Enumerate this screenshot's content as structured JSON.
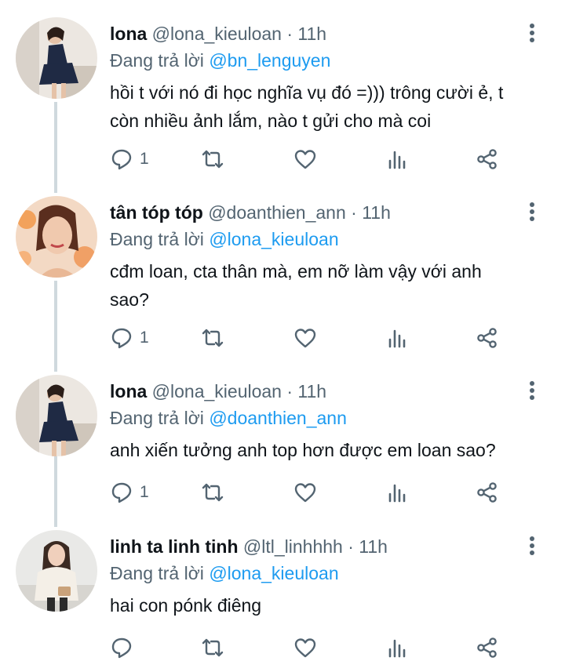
{
  "replying_label": "Đang trả lời",
  "colors": {
    "accent": "#1d9bf0",
    "muted": "#536471",
    "thread_line": "#cfd9de"
  },
  "tweets": [
    {
      "name": "lona",
      "handle": "@lona_kieuloan",
      "time": "· 11h",
      "reply_to": "@bn_lenguyen",
      "text_lines": [
        "hồi t với nó đi học nghĩa vụ đó =))) trông cười ẻ, t",
        "còn nhiều ảnh lắm, nào t gửi cho mà coi"
      ],
      "reply_count": "1",
      "avatar_icon": "avatar-lona"
    },
    {
      "name": "tân tóp tóp",
      "handle": "@doanthien_ann",
      "time": "· 11h",
      "reply_to": "@lona_kieuloan",
      "text_lines": [
        "cđm loan, cta thân mà, em nỡ làm vậy với anh",
        "sao?"
      ],
      "reply_count": "1",
      "avatar_icon": "avatar-tan"
    },
    {
      "name": "lona",
      "handle": "@lona_kieuloan",
      "time": "· 11h",
      "reply_to": "@doanthien_ann",
      "text_lines": [
        "anh xiến tưởng anh top hơn được em loan sao?"
      ],
      "reply_count": "1",
      "avatar_icon": "avatar-lona"
    },
    {
      "name": "linh ta linh tinh",
      "handle": "@ltl_linhhhh",
      "time": "· 11h",
      "reply_to": "@lona_kieuloan",
      "text_lines": [
        "hai con pónk điêng"
      ],
      "reply_count": "",
      "avatar_icon": "avatar-linh"
    }
  ]
}
